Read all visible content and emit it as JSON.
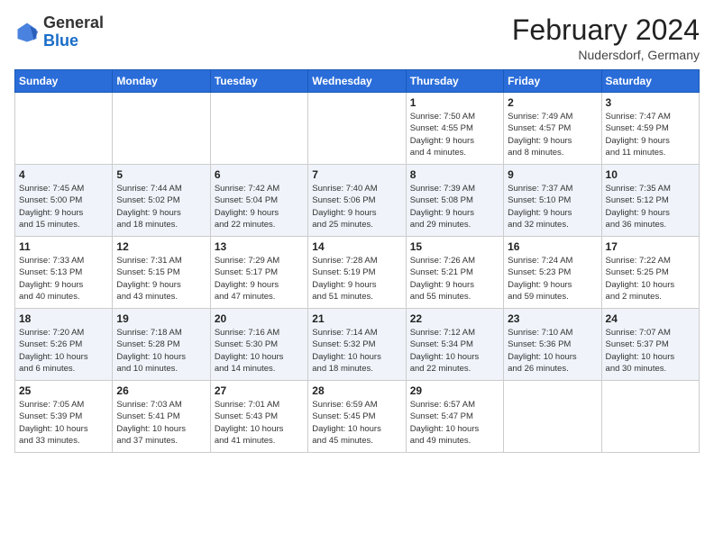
{
  "logo": {
    "line1": "General",
    "line2": "Blue"
  },
  "title": "February 2024",
  "subtitle": "Nudersdorf, Germany",
  "days_of_week": [
    "Sunday",
    "Monday",
    "Tuesday",
    "Wednesday",
    "Thursday",
    "Friday",
    "Saturday"
  ],
  "weeks": [
    [
      {
        "day": "",
        "info": ""
      },
      {
        "day": "",
        "info": ""
      },
      {
        "day": "",
        "info": ""
      },
      {
        "day": "",
        "info": ""
      },
      {
        "day": "1",
        "info": "Sunrise: 7:50 AM\nSunset: 4:55 PM\nDaylight: 9 hours\nand 4 minutes."
      },
      {
        "day": "2",
        "info": "Sunrise: 7:49 AM\nSunset: 4:57 PM\nDaylight: 9 hours\nand 8 minutes."
      },
      {
        "day": "3",
        "info": "Sunrise: 7:47 AM\nSunset: 4:59 PM\nDaylight: 9 hours\nand 11 minutes."
      }
    ],
    [
      {
        "day": "4",
        "info": "Sunrise: 7:45 AM\nSunset: 5:00 PM\nDaylight: 9 hours\nand 15 minutes."
      },
      {
        "day": "5",
        "info": "Sunrise: 7:44 AM\nSunset: 5:02 PM\nDaylight: 9 hours\nand 18 minutes."
      },
      {
        "day": "6",
        "info": "Sunrise: 7:42 AM\nSunset: 5:04 PM\nDaylight: 9 hours\nand 22 minutes."
      },
      {
        "day": "7",
        "info": "Sunrise: 7:40 AM\nSunset: 5:06 PM\nDaylight: 9 hours\nand 25 minutes."
      },
      {
        "day": "8",
        "info": "Sunrise: 7:39 AM\nSunset: 5:08 PM\nDaylight: 9 hours\nand 29 minutes."
      },
      {
        "day": "9",
        "info": "Sunrise: 7:37 AM\nSunset: 5:10 PM\nDaylight: 9 hours\nand 32 minutes."
      },
      {
        "day": "10",
        "info": "Sunrise: 7:35 AM\nSunset: 5:12 PM\nDaylight: 9 hours\nand 36 minutes."
      }
    ],
    [
      {
        "day": "11",
        "info": "Sunrise: 7:33 AM\nSunset: 5:13 PM\nDaylight: 9 hours\nand 40 minutes."
      },
      {
        "day": "12",
        "info": "Sunrise: 7:31 AM\nSunset: 5:15 PM\nDaylight: 9 hours\nand 43 minutes."
      },
      {
        "day": "13",
        "info": "Sunrise: 7:29 AM\nSunset: 5:17 PM\nDaylight: 9 hours\nand 47 minutes."
      },
      {
        "day": "14",
        "info": "Sunrise: 7:28 AM\nSunset: 5:19 PM\nDaylight: 9 hours\nand 51 minutes."
      },
      {
        "day": "15",
        "info": "Sunrise: 7:26 AM\nSunset: 5:21 PM\nDaylight: 9 hours\nand 55 minutes."
      },
      {
        "day": "16",
        "info": "Sunrise: 7:24 AM\nSunset: 5:23 PM\nDaylight: 9 hours\nand 59 minutes."
      },
      {
        "day": "17",
        "info": "Sunrise: 7:22 AM\nSunset: 5:25 PM\nDaylight: 10 hours\nand 2 minutes."
      }
    ],
    [
      {
        "day": "18",
        "info": "Sunrise: 7:20 AM\nSunset: 5:26 PM\nDaylight: 10 hours\nand 6 minutes."
      },
      {
        "day": "19",
        "info": "Sunrise: 7:18 AM\nSunset: 5:28 PM\nDaylight: 10 hours\nand 10 minutes."
      },
      {
        "day": "20",
        "info": "Sunrise: 7:16 AM\nSunset: 5:30 PM\nDaylight: 10 hours\nand 14 minutes."
      },
      {
        "day": "21",
        "info": "Sunrise: 7:14 AM\nSunset: 5:32 PM\nDaylight: 10 hours\nand 18 minutes."
      },
      {
        "day": "22",
        "info": "Sunrise: 7:12 AM\nSunset: 5:34 PM\nDaylight: 10 hours\nand 22 minutes."
      },
      {
        "day": "23",
        "info": "Sunrise: 7:10 AM\nSunset: 5:36 PM\nDaylight: 10 hours\nand 26 minutes."
      },
      {
        "day": "24",
        "info": "Sunrise: 7:07 AM\nSunset: 5:37 PM\nDaylight: 10 hours\nand 30 minutes."
      }
    ],
    [
      {
        "day": "25",
        "info": "Sunrise: 7:05 AM\nSunset: 5:39 PM\nDaylight: 10 hours\nand 33 minutes."
      },
      {
        "day": "26",
        "info": "Sunrise: 7:03 AM\nSunset: 5:41 PM\nDaylight: 10 hours\nand 37 minutes."
      },
      {
        "day": "27",
        "info": "Sunrise: 7:01 AM\nSunset: 5:43 PM\nDaylight: 10 hours\nand 41 minutes."
      },
      {
        "day": "28",
        "info": "Sunrise: 6:59 AM\nSunset: 5:45 PM\nDaylight: 10 hours\nand 45 minutes."
      },
      {
        "day": "29",
        "info": "Sunrise: 6:57 AM\nSunset: 5:47 PM\nDaylight: 10 hours\nand 49 minutes."
      },
      {
        "day": "",
        "info": ""
      },
      {
        "day": "",
        "info": ""
      }
    ]
  ]
}
